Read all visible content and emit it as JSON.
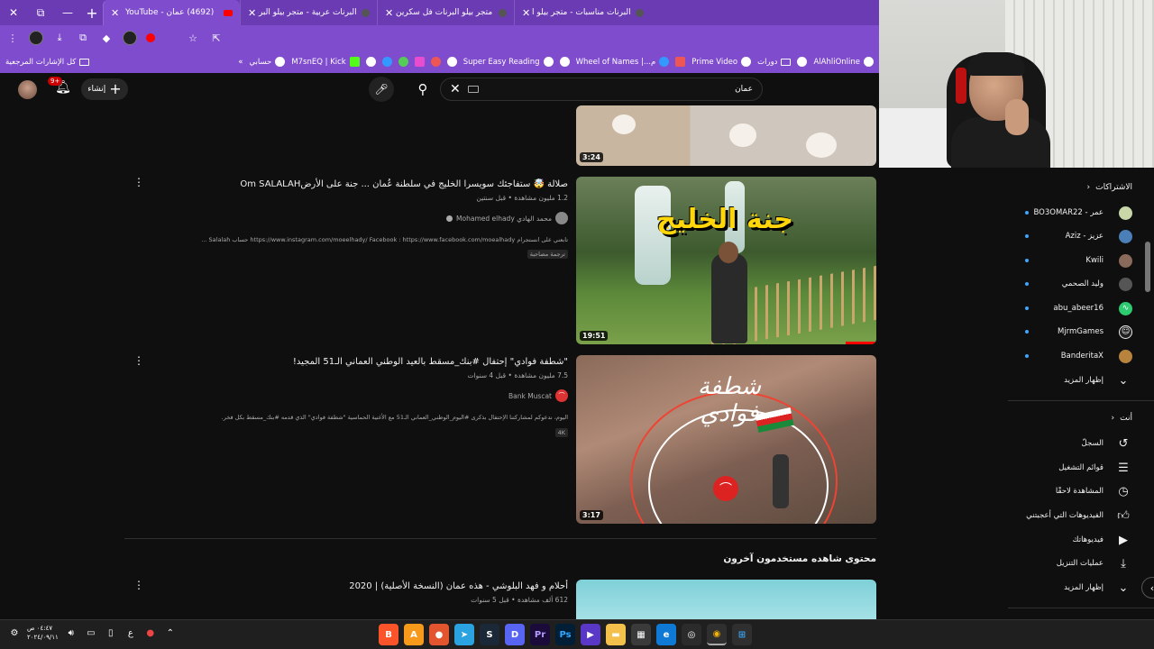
{
  "browser": {
    "tabs": [
      {
        "title": "البرنات مناسبات - متجر بيلو البرنات",
        "active": false
      },
      {
        "title": "متجر بيلو البرنات فل سكرين",
        "active": false
      },
      {
        "title": "البرنات عربية - متجر بيلو البرنات",
        "active": false
      },
      {
        "title": "(4692) عمان - YouTube",
        "active": true
      }
    ],
    "window_controls": [
      "close",
      "restore",
      "minimize"
    ],
    "new_tab": "+",
    "bookmarks": [
      {
        "label": "AlAhliOnline",
        "icon": "globe"
      },
      {
        "label": "",
        "icon": "globe"
      },
      {
        "label": "دورات",
        "icon": "folder"
      },
      {
        "label": "Prime Video",
        "icon": "globe"
      },
      {
        "label": "",
        "icon": "gmail"
      },
      {
        "label": "م...| Wheel of Names",
        "icon": "wheel"
      },
      {
        "label": "",
        "icon": "globe"
      },
      {
        "label": "Super Easy Reading",
        "icon": "globe"
      },
      {
        "label": "",
        "icon": "globe"
      },
      {
        "label": "",
        "icon": "acrobat"
      },
      {
        "label": "",
        "icon": "photos"
      },
      {
        "label": "",
        "icon": "download"
      },
      {
        "label": "",
        "icon": "edge"
      },
      {
        "label": "",
        "icon": "globe"
      },
      {
        "label": "M7snEQ | Kick",
        "icon": "kick"
      },
      {
        "label": "حسابي",
        "icon": "globe"
      }
    ],
    "bookmarks_overflow": "»",
    "all_bookmarks": "كل الإشارات المرجعية"
  },
  "youtube": {
    "search_value": "عمان",
    "create_label": "إنشاء",
    "notification_count": "9+",
    "results": [
      {
        "title": "",
        "duration": "3:24"
      },
      {
        "title": "صلالة 🤯 ستفاجئك سويسرا الخليج في سلطنة عُمان ... جنة على الأرضOm SALALAH",
        "views": "1.2 مليون مشاهدة",
        "age": "قبل سنتين",
        "channel": "محمد الهادي Mohamed elhady",
        "description": "تابعني على انستجرام https://www.instagram.com/moeelhady/ Facebook : https://www.facebook.com/moealhady حساب Salalah ...",
        "tag": "ترجمة مصاحبة",
        "duration": "19:51",
        "thumb_text": "جنة الخليج"
      },
      {
        "title": "\"شطفة فوادي\" إحتفال #بنك_مسقط بالعيد الوطني العماني الـ51 المجيد!",
        "views": "7.5 مليون مشاهدة",
        "age": "قبل 4 سنوات",
        "channel": "Bank Muscat",
        "description": "اليوم، ندعوكم لمشاركتنا الإحتفال بذكرى #اليوم_الوطني_العماني الـ51 مع الأغنية الحماسية \"شطفة فوادي\" الذي قدمه #بنك_مسقط بكل فخر.",
        "tag": "4K",
        "duration": "3:17",
        "thumb_text": "شطفة فوادي"
      },
      {
        "title": "أحلام و فهد البلوشي - هذه عمان (النسخة الأصلية) | 2020",
        "views": "612 ألف مشاهدة",
        "age": "قبل 5 سنوات"
      }
    ],
    "section_heading": "محتوى شاهده مستخدمون آخرون",
    "sidebar": {
      "subscriptions_heading": "الاشتراكات",
      "subscriptions": [
        {
          "label": "عمر - BO3OMAR22"
        },
        {
          "label": "عزيز - Aziz"
        },
        {
          "label": "Kwili"
        },
        {
          "label": "وليد الصحمي"
        },
        {
          "label": "abu_abeer16"
        },
        {
          "label": "MjrmGames"
        },
        {
          "label": "BanderitaX"
        }
      ],
      "show_more_1": "إظهار المزيد",
      "you_heading": "أنت",
      "you_items": [
        {
          "label": "السجلّ",
          "icon": "history-icon"
        },
        {
          "label": "قوائم التشغيل",
          "icon": "playlist-icon"
        },
        {
          "label": "المشاهدة لاحقًا",
          "icon": "clock-icon"
        },
        {
          "label": "الفيديوهات التي أعجبتني",
          "icon": "thumb-up-icon"
        },
        {
          "label": "فيديوهاتك",
          "icon": "play-square-icon"
        },
        {
          "label": "عمليات التنزيل",
          "icon": "download-icon"
        }
      ],
      "show_more_2": "إظهار المزيد"
    }
  },
  "taskbar": {
    "time": "٠٤:٤٧ ص",
    "date": "٢٠٢٤/٠٩/١١",
    "lang": "ع"
  },
  "colors": {
    "chrome_purple": "#7f4ccd",
    "yt_bg": "#0f0f0f",
    "accent_red": "#ff0000"
  }
}
